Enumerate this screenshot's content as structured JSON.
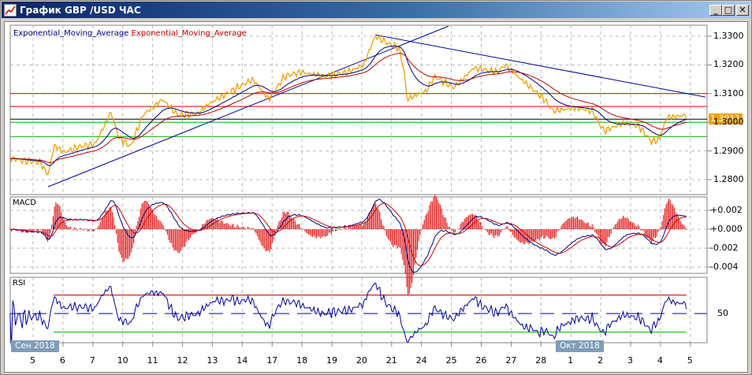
{
  "window": {
    "title": "График GBP /USD  ЧАС",
    "minimize": "_",
    "maximize": "□",
    "close": "✕",
    "icon": "chart-icon"
  },
  "legend": {
    "ema_fast": "Exponential_Moving_Average",
    "ema_slow": "Exponential_Moving_Average"
  },
  "panels": {
    "macd": "MACD",
    "rsi": "RSI"
  },
  "current_price": "1.3011",
  "date_boxes": [
    "Сен 2018",
    "Окт 2018"
  ],
  "colors": {
    "price": "#f0a000",
    "ema_fast": "#000080",
    "ema_slow": "#c00000",
    "trend": "#0000a0",
    "resistance": "#d00000",
    "support": "#00c000",
    "current": "#000000"
  },
  "chart_data": [
    {
      "type": "line",
      "title": "GBP/USD hourly",
      "ylabel": "",
      "ylim": [
        1.276,
        1.334
      ],
      "yticks": [
        "1.3300",
        "1.3200",
        "1.3100",
        "1.3000",
        "1.2900",
        "1.2800"
      ],
      "xticks": [
        "5",
        "6",
        "7",
        "10",
        "11",
        "12",
        "13",
        "14",
        "17",
        "18",
        "19",
        "20",
        "21",
        "24",
        "25",
        "26",
        "27",
        "28",
        "1",
        "2",
        "3",
        "4",
        "5"
      ],
      "price_points": [
        [
          -0.77,
          1.2875
        ],
        [
          -0.29,
          1.2865
        ],
        [
          0.24,
          1.286
        ],
        [
          0.5,
          1.2815
        ],
        [
          0.71,
          1.292
        ],
        [
          1.03,
          1.2895
        ],
        [
          1.56,
          1.2915
        ],
        [
          2.08,
          1.2925
        ],
        [
          2.61,
          1.3035
        ],
        [
          2.88,
          1.2945
        ],
        [
          3.27,
          1.2915
        ],
        [
          3.67,
          1.3025
        ],
        [
          4.33,
          1.308
        ],
        [
          4.85,
          1.3025
        ],
        [
          5.51,
          1.303
        ],
        [
          5.91,
          1.3066
        ],
        [
          6.83,
          1.312
        ],
        [
          7.36,
          1.315
        ],
        [
          7.89,
          1.308
        ],
        [
          8.42,
          1.316
        ],
        [
          8.94,
          1.3175
        ],
        [
          9.74,
          1.316
        ],
        [
          10.53,
          1.3175
        ],
        [
          11.06,
          1.32
        ],
        [
          11.45,
          1.33
        ],
        [
          11.98,
          1.327
        ],
        [
          12.24,
          1.326
        ],
        [
          12.43,
          1.3175
        ],
        [
          12.51,
          1.308
        ],
        [
          13.17,
          1.311
        ],
        [
          13.43,
          1.316
        ],
        [
          14.09,
          1.312
        ],
        [
          14.75,
          1.319
        ],
        [
          15.54,
          1.3175
        ],
        [
          15.8,
          1.32
        ],
        [
          16.33,
          1.315
        ],
        [
          17.12,
          1.308
        ],
        [
          17.39,
          1.304
        ],
        [
          18.18,
          1.305
        ],
        [
          18.71,
          1.304
        ],
        [
          19.1,
          1.297
        ],
        [
          19.76,
          1.2997
        ],
        [
          20.29,
          1.2985
        ],
        [
          20.69,
          1.2934
        ],
        [
          20.96,
          1.294
        ],
        [
          21.21,
          1.3017
        ],
        [
          21.87,
          1.3025
        ]
      ],
      "horizontal_levels": {
        "resistance": [
          1.31,
          1.3055
        ],
        "current": 1.3011,
        "support": [
          1.3,
          1.295
        ]
      },
      "trendlines": [
        [
          [
            0.5,
            1.2775
          ],
          [
            13.9,
            1.3335
          ]
        ],
        [
          [
            11.45,
            1.3305
          ],
          [
            22.5,
            1.3088
          ]
        ]
      ]
    },
    {
      "type": "line",
      "title": "MACD",
      "ylim": [
        -0.0045,
        0.003
      ],
      "yticks": [
        "+0.002",
        "+0.000",
        "-0.002",
        "-0.004"
      ]
    },
    {
      "type": "line",
      "title": "RSI",
      "ylim": [
        10,
        95
      ],
      "yticks": [
        "50"
      ],
      "levels": [
        70,
        30
      ]
    }
  ]
}
